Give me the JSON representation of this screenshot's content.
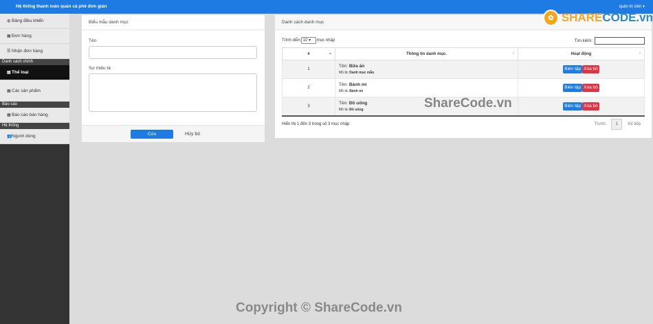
{
  "header": {
    "title": "Hệ thống thanh toán quán cà phê đơn giản",
    "user": "quản trị viên ▾"
  },
  "sidebar": {
    "items_top": [
      {
        "label": "Bảng điều khiển",
        "icon": "dashboard-icon"
      },
      {
        "label": "Đơn hàng",
        "icon": "orders-icon"
      },
      {
        "label": "Nhận đơn hàng",
        "icon": "list-icon"
      }
    ],
    "section_main": "Danh sách chính",
    "items_main": [
      {
        "label": "Thể loại",
        "icon": "category-icon"
      },
      {
        "label": "Các sản phẩm",
        "icon": "grid-icon"
      }
    ],
    "section_report": "Báo cáo",
    "items_report": [
      {
        "label": "Báo cáo bán hàng",
        "icon": "report-icon"
      }
    ],
    "section_system": "Hệ thống",
    "items_system": [
      {
        "label": "Người dùng",
        "icon": "users-icon"
      }
    ]
  },
  "form": {
    "title": "Biểu mẫu danh mục",
    "name_label": "Tên",
    "name_value": "",
    "desc_label": "Sự miêu tả",
    "desc_value": "",
    "save_label": "Cứu",
    "cancel_label": "Hủy bỏ"
  },
  "list": {
    "title": "Danh sách danh mục",
    "length_prefix": "Trình diễn",
    "length_value": "10 ▾",
    "length_suffix": "mục nhập",
    "search_label": "Tìm kiếm:",
    "search_value": "",
    "columns": [
      "#",
      "Thông tin danh mục.",
      "Hoạt động"
    ],
    "name_prefix": "Tên:",
    "desc_prefix": "Mô tả:",
    "edit_label": "Biên tập",
    "delete_label": "Xóa bỏ",
    "rows": [
      {
        "num": "1",
        "name": "Bữa ăn",
        "desc": "Danh mục mẫu"
      },
      {
        "num": "2",
        "name": "Bánh mì",
        "desc": "Bánh mì"
      },
      {
        "num": "3",
        "name": "Đồ uống",
        "desc": "Đồ uống"
      }
    ],
    "info": "Hiển thị 1 đến 3 trong số 3 mục nhập",
    "prev": "Trước",
    "page": "1",
    "next": "Kế tiếp"
  },
  "watermarks": {
    "logo_share": "SHARE",
    "logo_code": "CODE.vn",
    "center": "ShareCode.vn",
    "bottom": "Copyright © ShareCode.vn"
  }
}
